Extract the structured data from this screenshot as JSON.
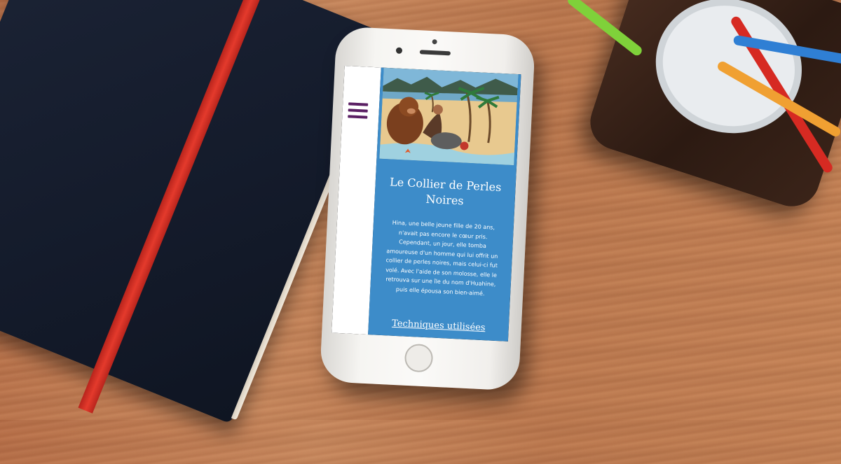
{
  "colors": {
    "content_background": "#3d8cc9",
    "sidebar_background": "#ffffff",
    "menu_icon": "#5a1f63",
    "text": "#ffffff"
  },
  "menu": {
    "icon": "hamburger-menu-icon"
  },
  "story": {
    "title": "Le Collier de Perles Noires",
    "body": "Hina, une belle jeune fille de 20 ans, n'avait pas encore le cœur pris. Cependant, un jour, elle tomba amoureuse d'un homme qui lui offrit un collier de perles noires, mais celui-ci fut volé. Avec l'aide de son molosse, elle le retrouva sur une île du nom d'Huahine, puis elle épousa son bien-aimé.",
    "link_label": "Techniques utilisées"
  }
}
